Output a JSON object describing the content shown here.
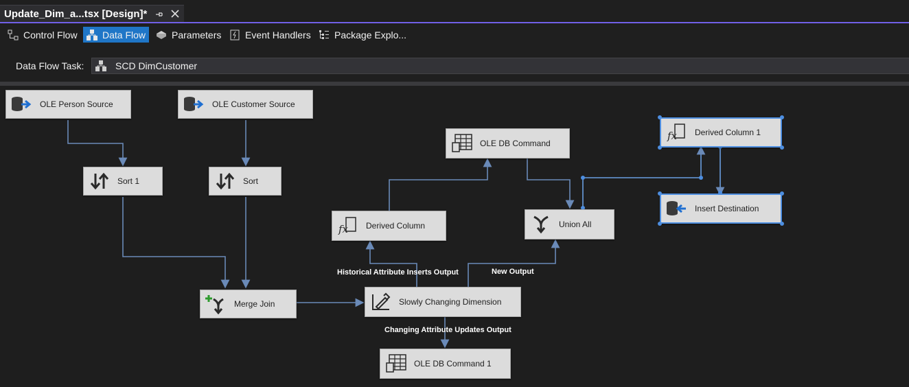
{
  "document_tab": {
    "title": "Update_Dim_a...tsx [Design]*"
  },
  "designer_tabs": [
    {
      "label": "Control Flow",
      "icon": "control-flow-icon",
      "active": false
    },
    {
      "label": "Data Flow",
      "icon": "data-flow-icon",
      "active": true
    },
    {
      "label": "Parameters",
      "icon": "parameters-icon",
      "active": false
    },
    {
      "label": "Event Handlers",
      "icon": "event-handlers-icon",
      "active": false
    },
    {
      "label": "Package Explo...",
      "icon": "package-explorer-icon",
      "active": false
    }
  ],
  "task_bar": {
    "label": "Data Flow Task:",
    "value": "SCD DimCustomer"
  },
  "components": {
    "ole_person_source": "OLE Person Source",
    "ole_customer_source": "OLE Customer Source",
    "sort_1": "Sort 1",
    "sort": "Sort",
    "merge_join": "Merge Join",
    "scd": "Slowly Changing Dimension",
    "derived_column": "Derived Column",
    "ole_db_command": "OLE DB Command",
    "union_all": "Union All",
    "derived_column_1": "Derived Column 1",
    "insert_destination": "Insert Destination",
    "ole_db_command_1": "OLE DB Command 1"
  },
  "outputs": {
    "historical": "Historical Attribute Inserts Output",
    "new": "New Output",
    "changing": "Changing Attribute Updates Output"
  },
  "colors": {
    "accent_tab_line": "#7160e8",
    "active_tab": "#1f76c7",
    "edge": "#6a8ab8",
    "selection": "#4d8ee0"
  }
}
